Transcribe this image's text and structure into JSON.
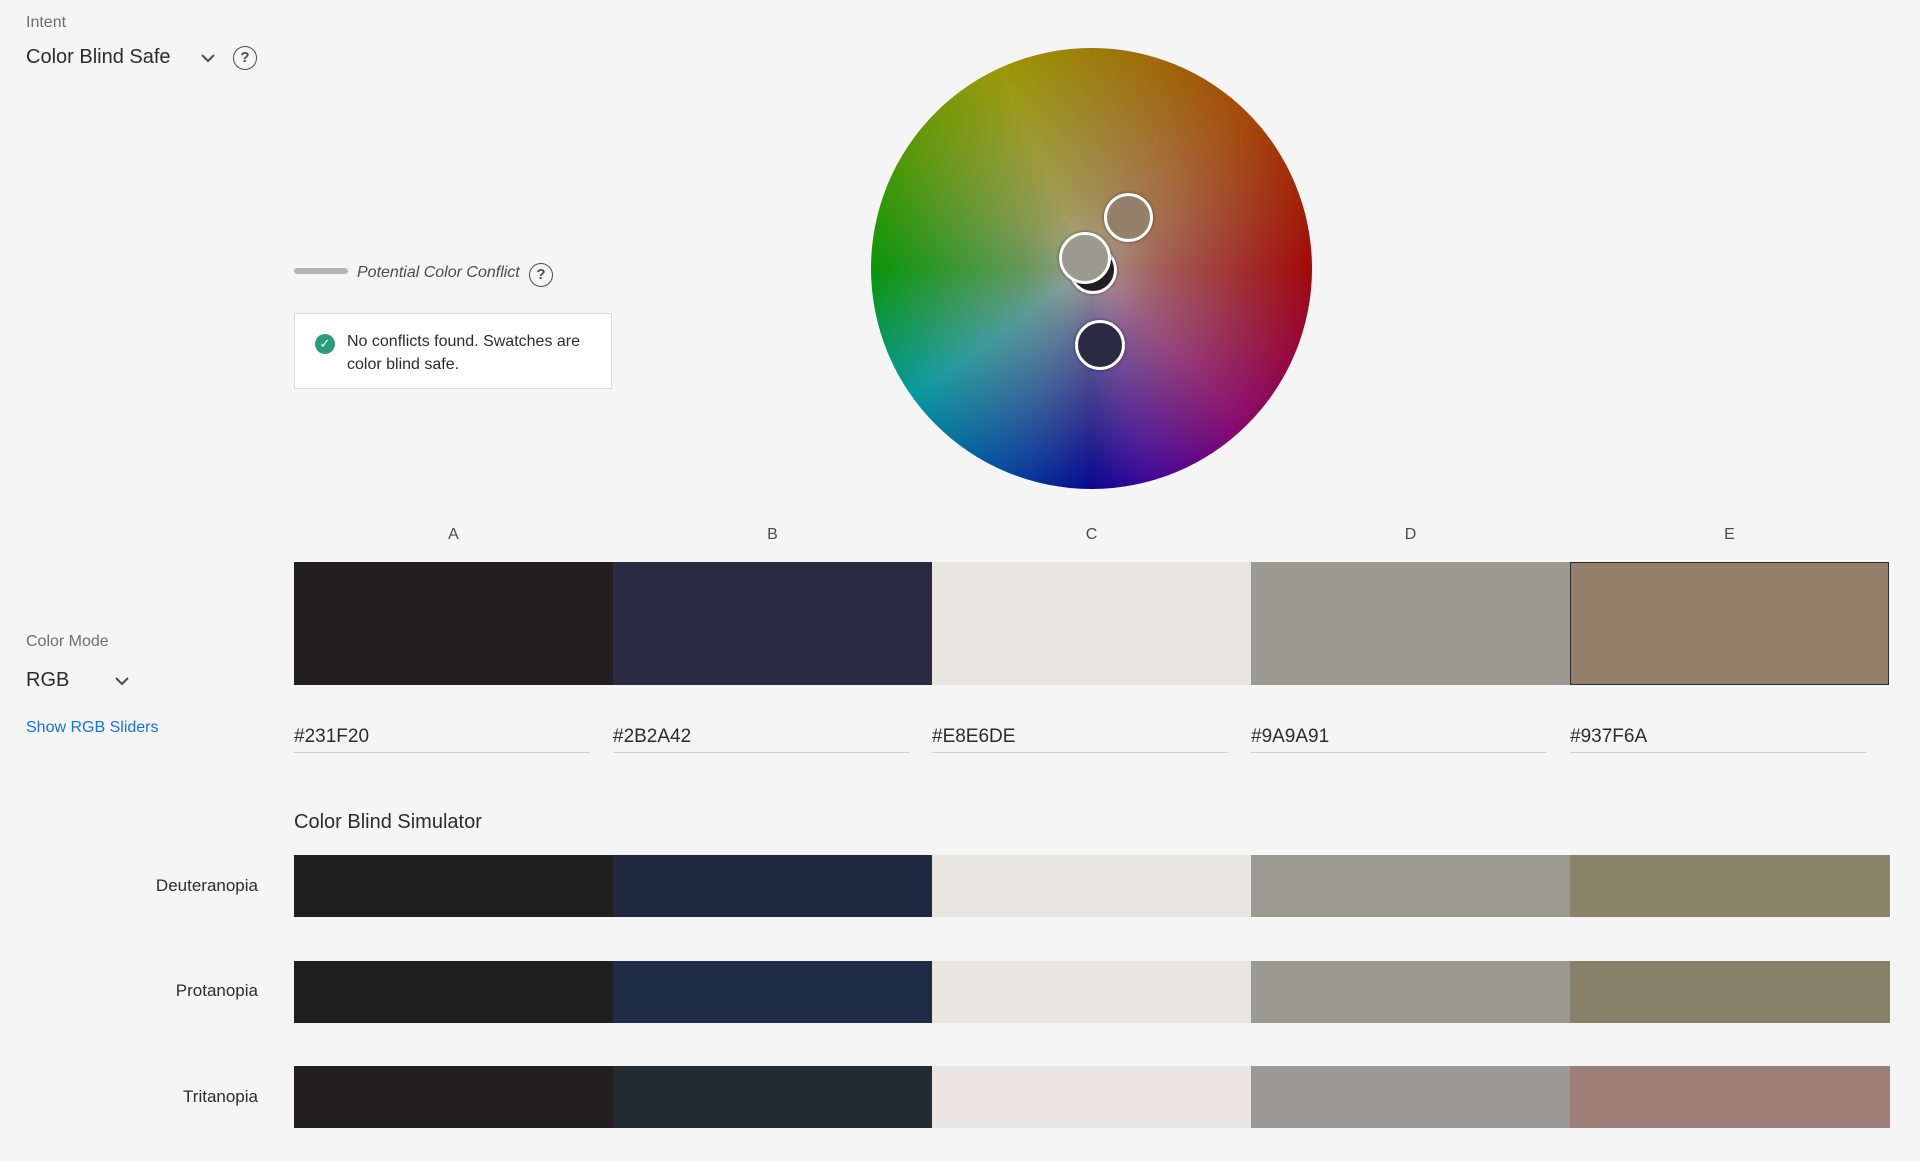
{
  "intent": {
    "label": "Intent",
    "value": "Color Blind Safe",
    "help": "?"
  },
  "conflict": {
    "label": "Potential Color Conflict",
    "help": "?",
    "status": "No conflicts found. Swatches are color blind safe."
  },
  "color_mode": {
    "label": "Color Mode",
    "value": "RGB",
    "sliders_link": "Show RGB Sliders"
  },
  "swatches": [
    {
      "letter": "A",
      "hex": "#231F20"
    },
    {
      "letter": "B",
      "hex": "#2B2A42"
    },
    {
      "letter": "C",
      "hex": "#E8E6DE"
    },
    {
      "letter": "D",
      "hex": "#9A9A91"
    },
    {
      "letter": "E",
      "hex": "#937F6A"
    }
  ],
  "simulator": {
    "title": "Color Blind Simulator",
    "rows": [
      {
        "name": "Deuteranopia",
        "colors": [
          "#1f1f1f",
          "#1f2a40",
          "#e8e6de",
          "#9c9a91",
          "#8c846a"
        ]
      },
      {
        "name": "Protanopia",
        "colors": [
          "#1f1f1f",
          "#1f2b45",
          "#e8e6df",
          "#9b9a91",
          "#878169"
        ]
      },
      {
        "name": "Tritanopia",
        "colors": [
          "#231e1f",
          "#222a32",
          "#ebe5e4",
          "#9b9897",
          "#9e7d79"
        ]
      }
    ]
  },
  "colors": {
    "accent": "#1473e6",
    "success": "#2d9d78"
  }
}
